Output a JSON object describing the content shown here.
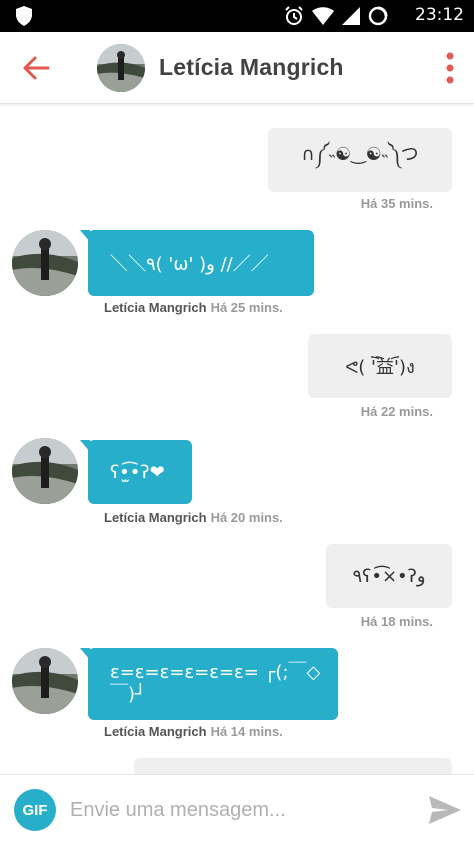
{
  "status_bar": {
    "time": "23:12"
  },
  "header": {
    "contact_name": "Letícia Mangrich"
  },
  "messages": [
    {
      "direction": "out",
      "text": "∩༼˵☯‿☯˵༽つ",
      "time": "Há 35 mins."
    },
    {
      "direction": "in",
      "text": "＼＼٩( 'ω' )و //／／",
      "sender": "Letícia Mangrich",
      "time": "Há 25 mins."
    },
    {
      "direction": "out",
      "text": "ᕙ( ︡'︡益'︠)ง",
      "time": "Há 22 mins."
    },
    {
      "direction": "in",
      "text": "ʕ•̫͡•ʔ❤",
      "sender": "Letícia Mangrich",
      "time": "Há 20 mins."
    },
    {
      "direction": "out",
      "text": "٩ʕ•͡×•ʔو",
      "time": "Há 18 mins."
    },
    {
      "direction": "in",
      "text": "ε=ε=ε=ε=ε=ε= ┌(;￣◇￣)┘",
      "sender": "Letícia Mangrich",
      "time": "Há 14 mins."
    }
  ],
  "composer": {
    "gif_label": "GIF",
    "placeholder": "Envie uma mensagem..."
  },
  "colors": {
    "accent": "#27aecb",
    "back_arrow": "#e5584f",
    "menu_dots": "#e5584f",
    "outgoing_bubble": "#efefef"
  }
}
